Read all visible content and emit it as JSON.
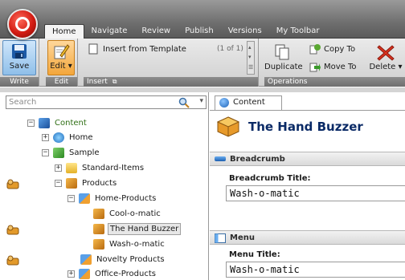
{
  "tabs": [
    "Home",
    "Navigate",
    "Review",
    "Publish",
    "Versions",
    "My Toolbar"
  ],
  "active_tab": "Home",
  "ribbon": {
    "write_group": {
      "title": "Write",
      "save_label": "Save"
    },
    "edit_group": {
      "title": "Edit",
      "edit_label": "Edit ▾"
    },
    "insert_group": {
      "title": "Insert",
      "template_label": "Insert from Template",
      "paging": "(1 of 1)"
    },
    "operations_group": {
      "title": "Operations",
      "duplicate_label": "Duplicate",
      "copy_to_label": "Copy To",
      "move_to_label": "Move To",
      "delete_label": "Delete ▾"
    }
  },
  "search": {
    "placeholder": "Search"
  },
  "tree": {
    "items": [
      {
        "label": "Content",
        "expander": "−",
        "icon": "content-icon"
      },
      {
        "label": "Home",
        "expander": "+",
        "icon": "home-icon"
      },
      {
        "label": "Sample",
        "expander": "−",
        "icon": "sample-icon"
      },
      {
        "label": "Standard-Items",
        "expander": "+",
        "icon": "folder-icon"
      },
      {
        "label": "Products",
        "expander": "−",
        "icon": "product-icon"
      },
      {
        "label": "Home-Products",
        "expander": "−",
        "icon": "product-group-icon"
      },
      {
        "label": "Cool-o-matic",
        "expander": "",
        "icon": "product-icon"
      },
      {
        "label": "The Hand Buzzer",
        "expander": "",
        "icon": "product-icon"
      },
      {
        "label": "Wash-o-matic",
        "expander": "",
        "icon": "product-icon"
      },
      {
        "label": "Novelty Products",
        "expander": "",
        "icon": "product-group-icon"
      },
      {
        "label": "Office-Products",
        "expander": "+",
        "icon": "product-group-icon"
      }
    ]
  },
  "content": {
    "tab_label": "Content",
    "item_title": "The Hand Buzzer",
    "sections": [
      {
        "title": "Breadcrumb",
        "field_label": "Breadcrumb Title:",
        "field_value": "Wash-o-matic"
      },
      {
        "title": "Menu",
        "field_label": "Menu Title:",
        "field_value": "Wash-o-matic"
      }
    ]
  },
  "colors": {
    "accent": "#0a2a66",
    "tree_root": "#2f6f15",
    "app_button": "#d21b12"
  }
}
